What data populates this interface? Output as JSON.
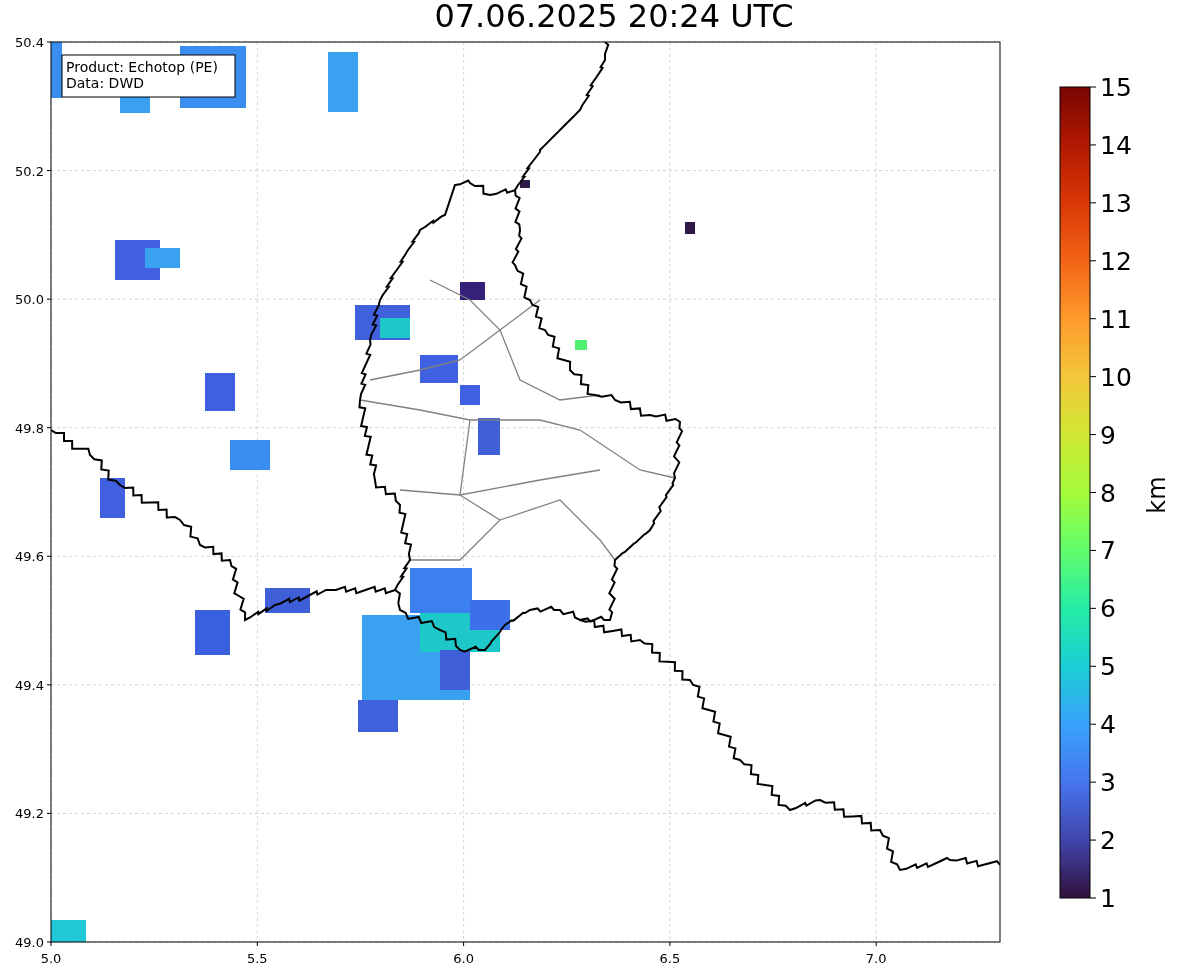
{
  "title": "07.06.2025 20:24 UTC",
  "legend": [
    "Product: Echotop (PE)",
    "Data: DWD"
  ],
  "x_axis": {
    "ticks": [
      "5.0",
      "5.5",
      "6.0",
      "6.5",
      "7.0"
    ]
  },
  "y_axis": {
    "ticks": [
      "50.4",
      "50.2",
      "50.0",
      "49.8",
      "49.6",
      "49.4",
      "49.2",
      "49.0"
    ]
  },
  "colorbar": {
    "label": "km",
    "ticks": [
      "15",
      "14",
      "13",
      "12",
      "11",
      "10",
      "9",
      "8",
      "7",
      "6",
      "5",
      "4",
      "3",
      "2",
      "1"
    ]
  }
}
